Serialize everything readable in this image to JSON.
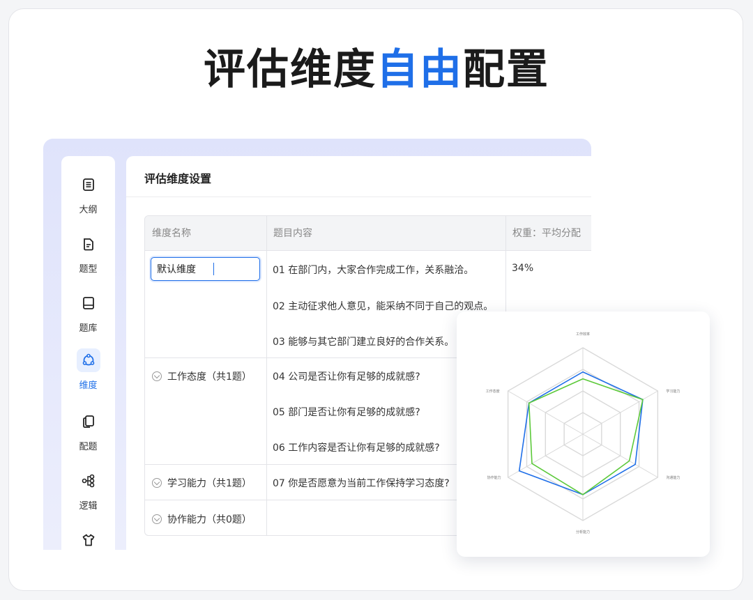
{
  "headline": {
    "part1": "评估维度",
    "highlight": "自由",
    "part2": "配置"
  },
  "colors": {
    "accent": "#1f6fe8",
    "radar_series_1": "#1f6fe8",
    "radar_series_2": "#5cc93a"
  },
  "sidebar": {
    "items": [
      {
        "label": "大纲",
        "icon": "outline-icon",
        "active": false
      },
      {
        "label": "题型",
        "icon": "question-type-icon",
        "active": false
      },
      {
        "label": "题库",
        "icon": "question-bank-icon",
        "active": false
      },
      {
        "label": "维度",
        "icon": "dimension-icon",
        "active": true
      },
      {
        "label": "配题",
        "icon": "assign-questions-icon",
        "active": false
      },
      {
        "label": "逻辑",
        "icon": "logic-icon",
        "active": false
      },
      {
        "label": "",
        "icon": "theme-shirt-icon",
        "active": false
      }
    ]
  },
  "main": {
    "title": "评估维度设置",
    "table": {
      "headers": [
        "维度名称",
        "题目内容",
        "权重：平均分配"
      ],
      "name_input_value": "默认维度",
      "default_weight": "34%",
      "questions": [
        "01 在部门内，大家合作完成工作，关系融洽。",
        "02 主动征求他人意见，能采纳不同于自己的观点。",
        "03 能够与其它部门建立良好的合作关系。",
        "04 公司是否让你有足够的成就感?",
        "05 部门是否让你有足够的成就感?",
        "06 工作内容是否让你有足够的成就感?",
        "07 你是否愿意为当前工作保持学习态度?"
      ],
      "groups": [
        "工作态度（共1题）",
        "学习能力（共1题）",
        "协作能力（共0题）"
      ]
    }
  },
  "chart_data": {
    "type": "radar",
    "axes": [
      "工作效率",
      "学习能力",
      "沟通能力",
      "分析能力",
      "协作能力",
      "工作态度"
    ],
    "rmax": 100,
    "rings": 4,
    "series": [
      {
        "values": [
          72,
          80,
          70,
          70,
          85,
          72
        ]
      },
      {
        "values": [
          64,
          80,
          62,
          70,
          68,
          72
        ]
      }
    ]
  }
}
